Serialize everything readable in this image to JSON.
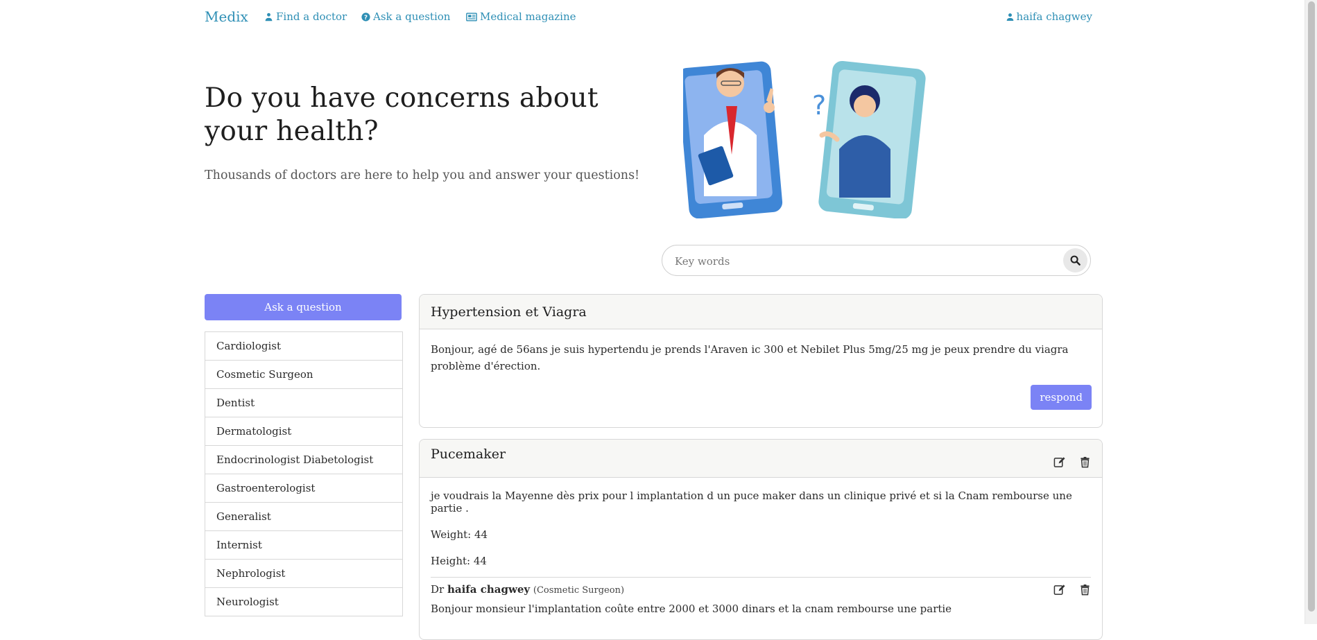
{
  "nav": {
    "brand": "Medix",
    "find_doctor": "Find a doctor",
    "ask_question": "Ask a question",
    "magazine": "Medical magazine",
    "user": "haifa chagwey"
  },
  "hero": {
    "title": "Do you have concerns about your health?",
    "subtitle": "Thousands of doctors are here to help you and answer your questions!",
    "illustration_question_mark": "?"
  },
  "search": {
    "placeholder": "Key words",
    "value": ""
  },
  "sidebar": {
    "ask_button": "Ask a question",
    "specialties": [
      "Cardiologist",
      "Cosmetic Surgeon",
      "Dentist",
      "Dermatologist",
      "Endocrinologist Diabetologist",
      "Gastroenterologist",
      "Generalist",
      "Internist",
      "Nephrologist",
      "Neurologist"
    ]
  },
  "questions": [
    {
      "title": "Hypertension et Viagra",
      "body": "Bonjour, agé de 56ans je suis hypertendu je prends l'Araven ic 300 et Nebilet Plus 5mg/25 mg je peux prendre du viagra problème d'érection.",
      "respond_label": "respond"
    },
    {
      "title": "Pucemaker",
      "body": "je voudrais la Mayenne dès prix pour l implantation d un puce maker dans un clinique privé et si la Cnam rembourse une partie .",
      "weight": "Weight: 44",
      "height": "Height: 44",
      "answer": {
        "prefix": "Dr",
        "doctor": "haifa chagwey",
        "specialty": "(Cosmetic Surgeon)",
        "text": "Bonjour monsieur l'implantation coûte entre 2000 et 3000 dinars et la cnam rembourse une partie"
      }
    }
  ],
  "colors": {
    "link": "#2e8fb5",
    "primary_button": "#7b83f5"
  },
  "icons": [
    "user-md-icon",
    "question-circle-icon",
    "newspaper-icon",
    "user-icon",
    "search-icon",
    "edit-icon",
    "trash-icon"
  ]
}
